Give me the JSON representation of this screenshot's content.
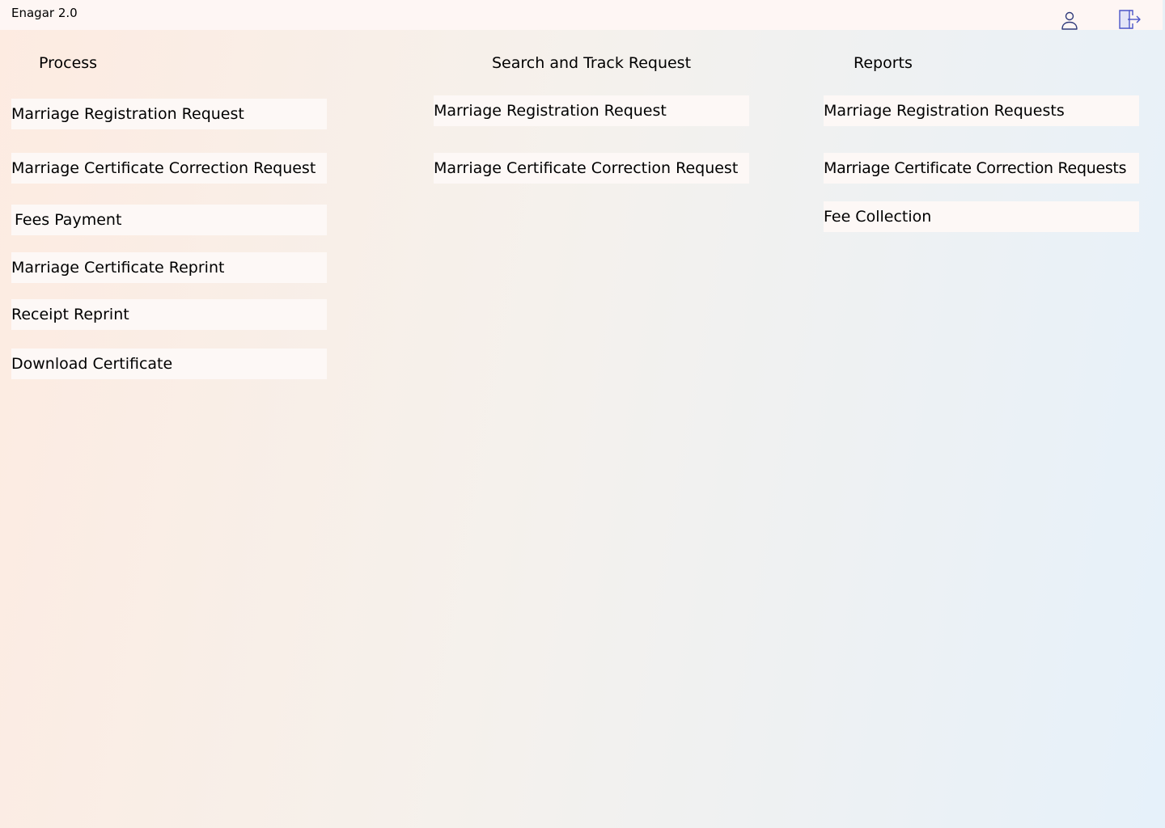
{
  "header": {
    "title": "Enagar 2.0",
    "user_icon": "user-icon",
    "logout_icon": "logout-icon",
    "accent_color": "#4a55c8"
  },
  "process": {
    "heading": "Process",
    "items": [
      {
        "label": "Marriage Registration Request"
      },
      {
        "label": "Marriage Certificate Correction Request"
      },
      {
        "label": "Fees Payment"
      },
      {
        "label": "Marriage Certificate Reprint"
      },
      {
        "label": "Receipt Reprint"
      },
      {
        "label": "Download Certificate"
      }
    ]
  },
  "track": {
    "heading": "Search and Track Request",
    "items": [
      {
        "label": "Marriage Registration Request"
      },
      {
        "label": "Marriage Certificate Correction Request"
      }
    ]
  },
  "reports": {
    "heading": "Reports",
    "items": [
      {
        "label": "Marriage Registration Requests"
      },
      {
        "label": "Marriage Certificate Correction Requests"
      },
      {
        "label": "Fee Collection"
      }
    ]
  }
}
